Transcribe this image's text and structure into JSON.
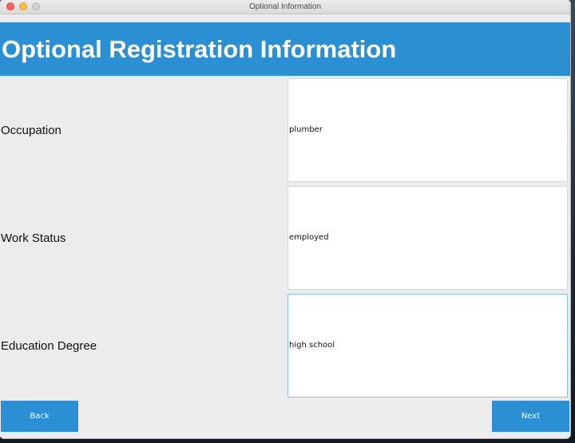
{
  "window": {
    "title": "Optional Information"
  },
  "header": {
    "title": "Optional Registration Information"
  },
  "form": {
    "rows": [
      {
        "label": "Occupation",
        "value": "plumber"
      },
      {
        "label": "Work Status",
        "value": "employed"
      },
      {
        "label": "Education Degree",
        "value": "high school"
      }
    ]
  },
  "buttons": {
    "back_label": "Back",
    "next_label": "Next"
  },
  "colors": {
    "accent": "#2b8fd3",
    "window_bg": "#ececec",
    "field_bg": "#ffffff"
  }
}
